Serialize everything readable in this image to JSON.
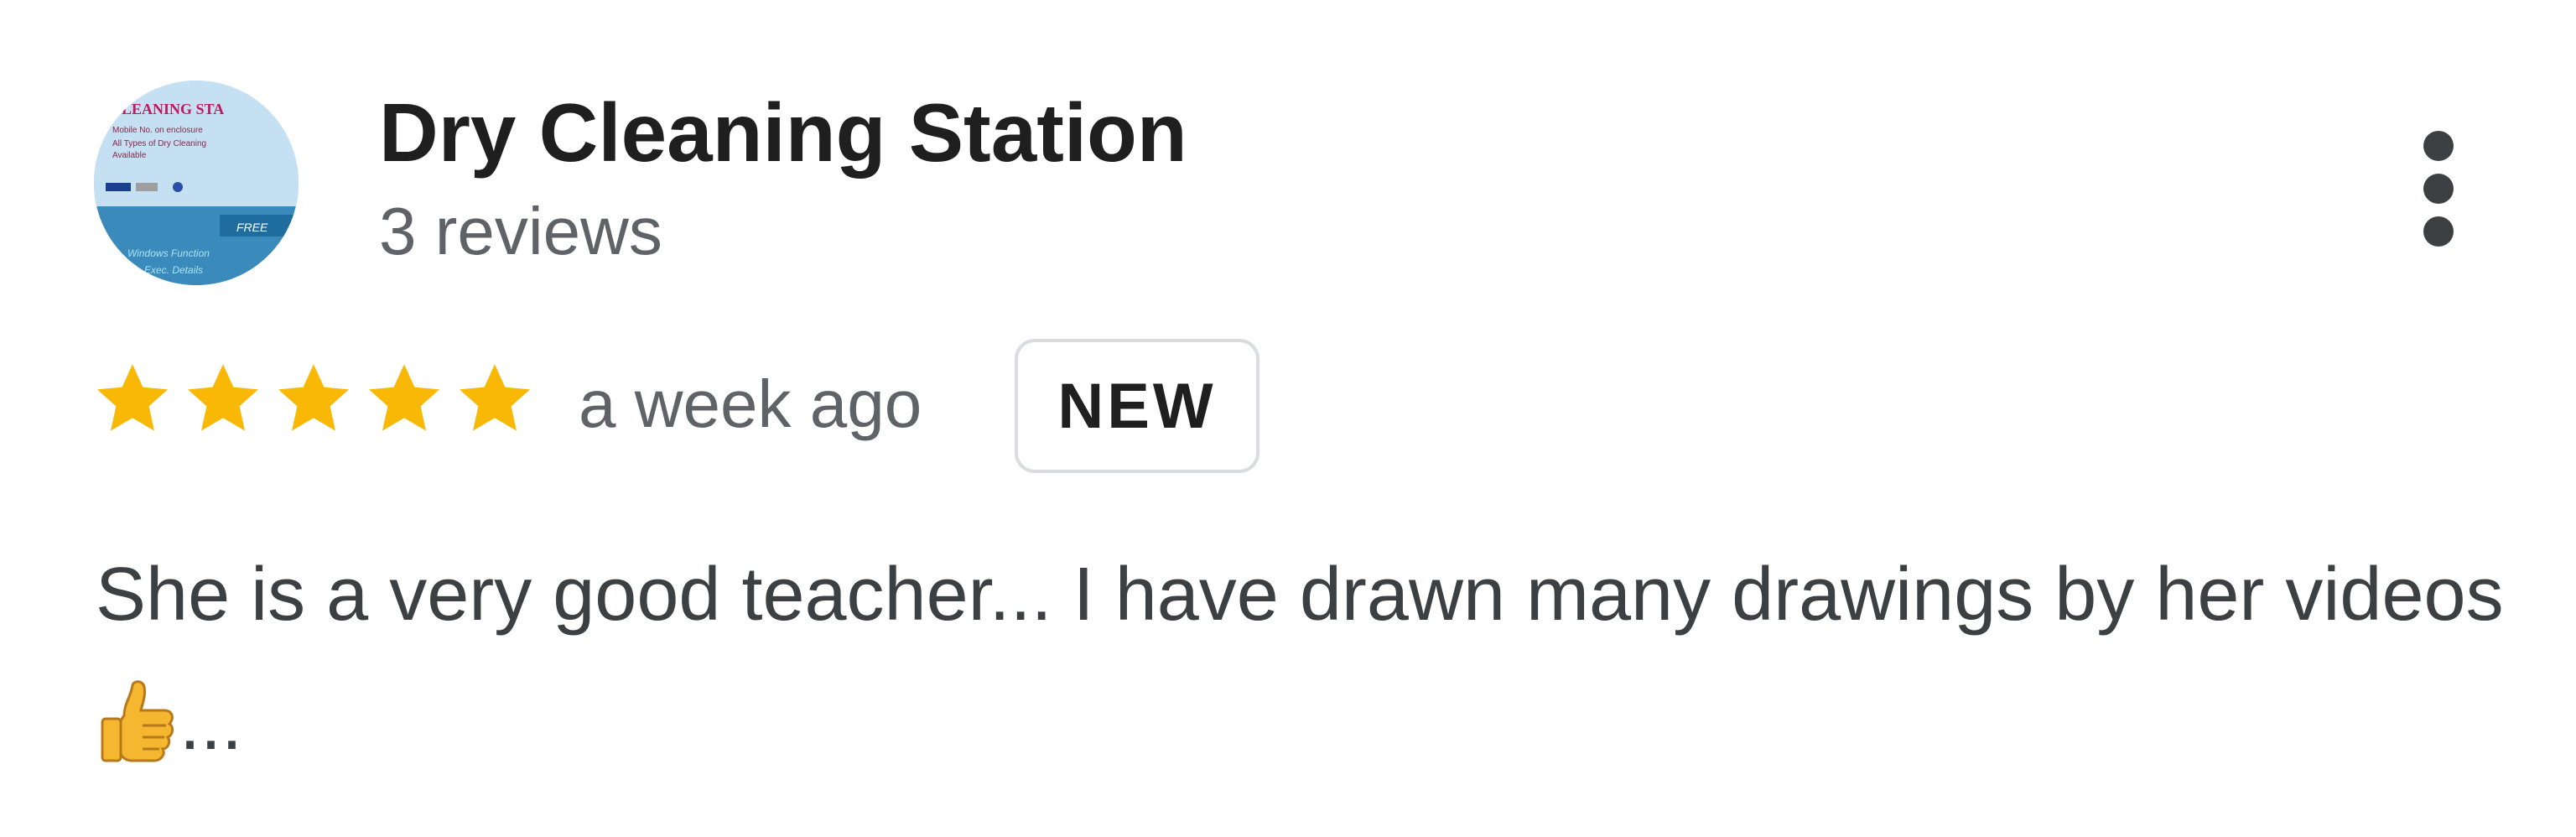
{
  "review": {
    "author_name": "Dry Cleaning Station",
    "review_count": "3 reviews",
    "rating": 5,
    "rating_max": 5,
    "time_ago": "a week ago",
    "badge": "NEW",
    "text_part1": "She is a very good teacher... I have drawn many drawings by her videos",
    "text_part2": "...",
    "inline_emoji": "thumbs-up-icon"
  },
  "avatar": {
    "line1": "CLEANING STA",
    "line2": "Mobile No. on enclosure",
    "line3": "All Types of Dry Cleaning",
    "line4": "Available",
    "line5": "FREE",
    "line6": "Windows Function",
    "line7": "Exec. Details"
  },
  "colors": {
    "star_filled": "#f9b806",
    "name_text": "#1f1f1f",
    "secondary_text": "#5f6368",
    "badge_border": "#dadce0"
  },
  "icons": {
    "menu": "more-vertical-icon",
    "star": "star-icon"
  }
}
